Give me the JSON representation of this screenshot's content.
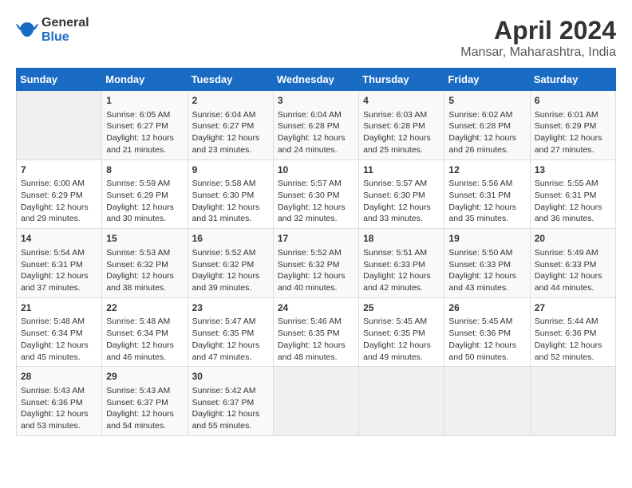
{
  "header": {
    "logo_line1": "General",
    "logo_line2": "Blue",
    "month_title": "April 2024",
    "location": "Mansar, Maharashtra, India"
  },
  "days_of_week": [
    "Sunday",
    "Monday",
    "Tuesday",
    "Wednesday",
    "Thursday",
    "Friday",
    "Saturday"
  ],
  "weeks": [
    [
      {
        "day": "",
        "info": ""
      },
      {
        "day": "1",
        "info": "Sunrise: 6:05 AM\nSunset: 6:27 PM\nDaylight: 12 hours\nand 21 minutes."
      },
      {
        "day": "2",
        "info": "Sunrise: 6:04 AM\nSunset: 6:27 PM\nDaylight: 12 hours\nand 23 minutes."
      },
      {
        "day": "3",
        "info": "Sunrise: 6:04 AM\nSunset: 6:28 PM\nDaylight: 12 hours\nand 24 minutes."
      },
      {
        "day": "4",
        "info": "Sunrise: 6:03 AM\nSunset: 6:28 PM\nDaylight: 12 hours\nand 25 minutes."
      },
      {
        "day": "5",
        "info": "Sunrise: 6:02 AM\nSunset: 6:28 PM\nDaylight: 12 hours\nand 26 minutes."
      },
      {
        "day": "6",
        "info": "Sunrise: 6:01 AM\nSunset: 6:29 PM\nDaylight: 12 hours\nand 27 minutes."
      }
    ],
    [
      {
        "day": "7",
        "info": "Sunrise: 6:00 AM\nSunset: 6:29 PM\nDaylight: 12 hours\nand 29 minutes."
      },
      {
        "day": "8",
        "info": "Sunrise: 5:59 AM\nSunset: 6:29 PM\nDaylight: 12 hours\nand 30 minutes."
      },
      {
        "day": "9",
        "info": "Sunrise: 5:58 AM\nSunset: 6:30 PM\nDaylight: 12 hours\nand 31 minutes."
      },
      {
        "day": "10",
        "info": "Sunrise: 5:57 AM\nSunset: 6:30 PM\nDaylight: 12 hours\nand 32 minutes."
      },
      {
        "day": "11",
        "info": "Sunrise: 5:57 AM\nSunset: 6:30 PM\nDaylight: 12 hours\nand 33 minutes."
      },
      {
        "day": "12",
        "info": "Sunrise: 5:56 AM\nSunset: 6:31 PM\nDaylight: 12 hours\nand 35 minutes."
      },
      {
        "day": "13",
        "info": "Sunrise: 5:55 AM\nSunset: 6:31 PM\nDaylight: 12 hours\nand 36 minutes."
      }
    ],
    [
      {
        "day": "14",
        "info": "Sunrise: 5:54 AM\nSunset: 6:31 PM\nDaylight: 12 hours\nand 37 minutes."
      },
      {
        "day": "15",
        "info": "Sunrise: 5:53 AM\nSunset: 6:32 PM\nDaylight: 12 hours\nand 38 minutes."
      },
      {
        "day": "16",
        "info": "Sunrise: 5:52 AM\nSunset: 6:32 PM\nDaylight: 12 hours\nand 39 minutes."
      },
      {
        "day": "17",
        "info": "Sunrise: 5:52 AM\nSunset: 6:32 PM\nDaylight: 12 hours\nand 40 minutes."
      },
      {
        "day": "18",
        "info": "Sunrise: 5:51 AM\nSunset: 6:33 PM\nDaylight: 12 hours\nand 42 minutes."
      },
      {
        "day": "19",
        "info": "Sunrise: 5:50 AM\nSunset: 6:33 PM\nDaylight: 12 hours\nand 43 minutes."
      },
      {
        "day": "20",
        "info": "Sunrise: 5:49 AM\nSunset: 6:33 PM\nDaylight: 12 hours\nand 44 minutes."
      }
    ],
    [
      {
        "day": "21",
        "info": "Sunrise: 5:48 AM\nSunset: 6:34 PM\nDaylight: 12 hours\nand 45 minutes."
      },
      {
        "day": "22",
        "info": "Sunrise: 5:48 AM\nSunset: 6:34 PM\nDaylight: 12 hours\nand 46 minutes."
      },
      {
        "day": "23",
        "info": "Sunrise: 5:47 AM\nSunset: 6:35 PM\nDaylight: 12 hours\nand 47 minutes."
      },
      {
        "day": "24",
        "info": "Sunrise: 5:46 AM\nSunset: 6:35 PM\nDaylight: 12 hours\nand 48 minutes."
      },
      {
        "day": "25",
        "info": "Sunrise: 5:45 AM\nSunset: 6:35 PM\nDaylight: 12 hours\nand 49 minutes."
      },
      {
        "day": "26",
        "info": "Sunrise: 5:45 AM\nSunset: 6:36 PM\nDaylight: 12 hours\nand 50 minutes."
      },
      {
        "day": "27",
        "info": "Sunrise: 5:44 AM\nSunset: 6:36 PM\nDaylight: 12 hours\nand 52 minutes."
      }
    ],
    [
      {
        "day": "28",
        "info": "Sunrise: 5:43 AM\nSunset: 6:36 PM\nDaylight: 12 hours\nand 53 minutes."
      },
      {
        "day": "29",
        "info": "Sunrise: 5:43 AM\nSunset: 6:37 PM\nDaylight: 12 hours\nand 54 minutes."
      },
      {
        "day": "30",
        "info": "Sunrise: 5:42 AM\nSunset: 6:37 PM\nDaylight: 12 hours\nand 55 minutes."
      },
      {
        "day": "",
        "info": ""
      },
      {
        "day": "",
        "info": ""
      },
      {
        "day": "",
        "info": ""
      },
      {
        "day": "",
        "info": ""
      }
    ]
  ]
}
